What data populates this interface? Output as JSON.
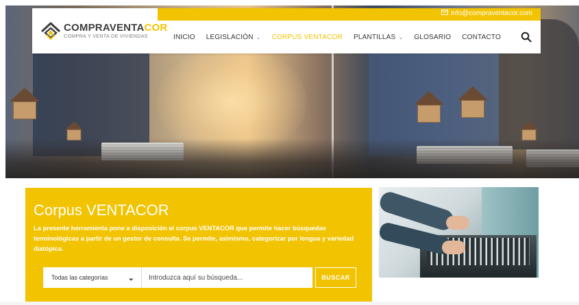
{
  "header": {
    "logo": {
      "title_main": "COMPRAVENTA",
      "title_accent": "COR",
      "subtitle": "COMPRA Y VENTA DE VIVIENDAS"
    },
    "email": "info@compraventacor.com",
    "nav": [
      {
        "label": "INICIO",
        "has_dropdown": false,
        "active": false
      },
      {
        "label": "LEGISLACIÓN",
        "has_dropdown": true,
        "active": false
      },
      {
        "label": "CORPUS VENTACOR",
        "has_dropdown": false,
        "active": true
      },
      {
        "label": "PLANTILLAS",
        "has_dropdown": true,
        "active": false
      },
      {
        "label": "GLOSARIO",
        "has_dropdown": false,
        "active": false
      },
      {
        "label": "CONTACTO",
        "has_dropdown": false,
        "active": false
      }
    ],
    "search_icon": "search-icon"
  },
  "corpus": {
    "title": "Corpus VENTACOR",
    "description": "La presente herramienta pone a disposición el corpus VENTACOR que permite hacer búsquedas terminológicas a partir de un gestor de consulta. Se permite, asimismo, categorizar por lengua y variedad diatópica.",
    "category_select": "Todas las categorías",
    "query_placeholder": "Introduzca aquí su búsqueda...",
    "search_button": "BUSCAR"
  },
  "colors": {
    "accent": "#f2c300",
    "text_dark": "#333333"
  }
}
